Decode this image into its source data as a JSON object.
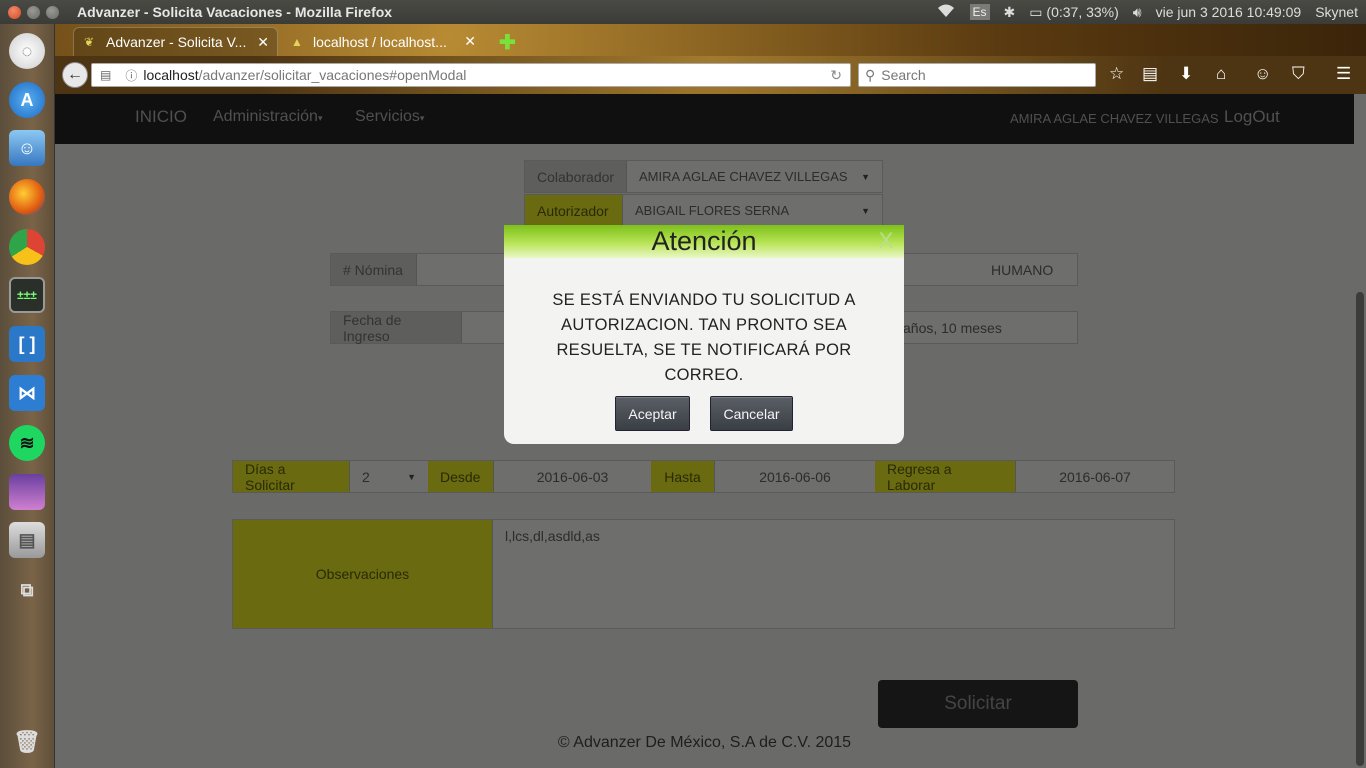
{
  "os": {
    "window_title": "Advanzer - Solicita Vacaciones - Mozilla Firefox",
    "input_lang": "Es",
    "battery": "(0:37, 33%)",
    "datetime": "vie jun  3 2016 10:49:09",
    "user": "Skynet"
  },
  "browser": {
    "tabs": [
      {
        "label": "Advanzer - Solicita V..."
      },
      {
        "label": "localhost / localhost..."
      }
    ],
    "url_host": "localhost",
    "url_path": "/advanzer/solicitar_vacaciones#openModal",
    "search_placeholder": "Search"
  },
  "app": {
    "nav": {
      "home": "INICIO",
      "admin": "Administración",
      "services": "Servicios",
      "user": "AMIRA AGLAE CHAVEZ VILLEGAS",
      "logout": "LogOut"
    },
    "form": {
      "colaborador_label": "Colaborador",
      "colaborador_value": "AMIRA AGLAE CHAVEZ VILLEGAS",
      "autorizador_label": "Autorizador",
      "autorizador_value": "ABIGAIL FLORES SERNA",
      "nomina_label": "# Nómina",
      "area_value_partial": "HUMANO",
      "ingreso_label": "Fecha de Ingreso",
      "antiguedad_partial": "años, 10 meses",
      "dias_label": "Días a Solicitar",
      "dias_value": "2",
      "desde_label": "Desde",
      "desde_value": "2016-06-03",
      "hasta_label": "Hasta",
      "hasta_value": "2016-06-06",
      "regresa_label": "Regresa a Laborar",
      "regresa_value": "2016-06-07",
      "obs_label": "Observaciones",
      "obs_value": "l,lcs,dl,asdld,as",
      "submit": "Solicitar"
    },
    "footer": "© Advanzer De México, S.A de C.V. 2015"
  },
  "modal": {
    "title": "Atención",
    "close": "X",
    "message": "SE ESTÁ ENVIANDO TU SOLICITUD A AUTORIZACION. TAN PRONTO SEA RESUELTA, SE TE NOTIFICARÁ POR CORREO.",
    "accept": "Aceptar",
    "cancel": "Cancelar"
  }
}
